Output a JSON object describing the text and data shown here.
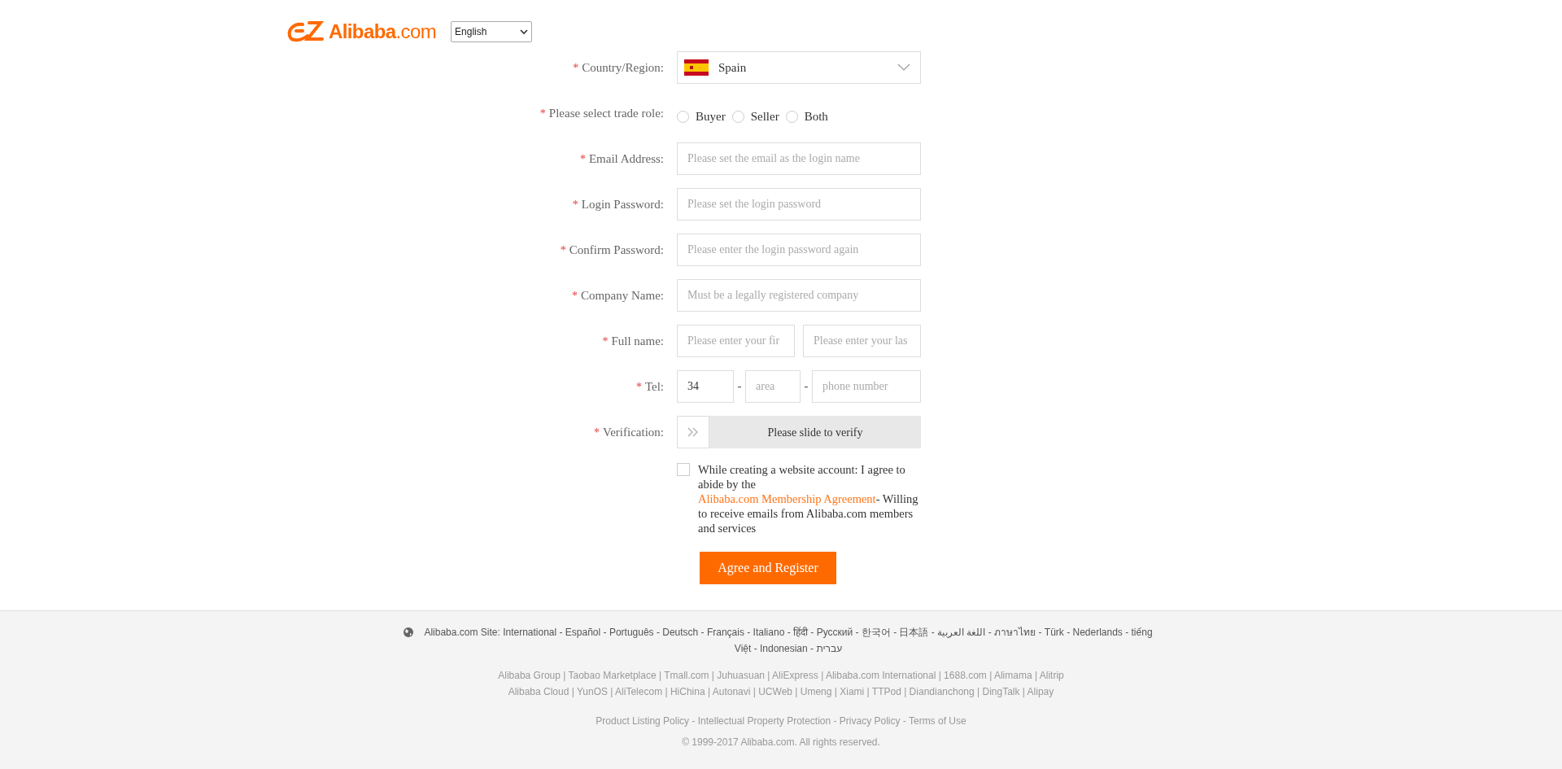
{
  "header": {
    "logo_text": "**Alibaba**.com",
    "language": "English"
  },
  "form": {
    "fields": [
      {
        "kind": "country",
        "mark": "*",
        "label": "Country/Region:",
        "value": "Spain"
      },
      {
        "kind": "radio",
        "mark": "*",
        "label": "Please select trade role:",
        "options": [
          {
            "label": "Buyer",
            "selected": false
          },
          {
            "label": "Seller",
            "selected": false
          },
          {
            "label": "Both",
            "selected": false
          }
        ]
      },
      {
        "kind": "input",
        "mark": "*",
        "label": "Email Address:",
        "placeholder": "Please set the email as the login name"
      },
      {
        "kind": "input",
        "mark": "*",
        "label": "Login Password:",
        "placeholder": "Please set the login password"
      },
      {
        "kind": "input",
        "mark": "*",
        "label": "Confirm Password:",
        "placeholder": "Please enter the login password again"
      },
      {
        "kind": "input",
        "mark": "*",
        "label": "Company Name:",
        "placeholder": "Must be a legally registered company"
      },
      {
        "kind": "pair",
        "mark": "*",
        "label": "Full name:",
        "inputs": [
          {
            "placeholder": "Please enter your fir"
          },
          {
            "placeholder": "Please enter your las"
          }
        ]
      },
      {
        "kind": "tel",
        "mark": "*",
        "label": "Tel:",
        "code": "34",
        "separators": [
          "-",
          "-"
        ],
        "inputs": [
          {
            "placeholder": "area"
          },
          {
            "placeholder": "phone number"
          }
        ]
      },
      {
        "kind": "slider",
        "mark": "*",
        "label": "Verification:",
        "text": "Please slide to verify",
        "level": 0
      }
    ],
    "agreement": {
      "checked": false,
      "before": "While creating a website account: I agree to abide by the",
      "link": "Alibaba.com Membership Agreement",
      "after": "- Willing to receive emails from Alibaba.com members and services"
    },
    "submit": "Agree and Register"
  },
  "footer": {
    "sites": "Alibaba.com Site: International - Español - Português - Deutsch - Français - Italiano - हिंदी - Русский - 한국어 - 日本語 - اللغة العربية - ภาษาไทย - Türk - Nederlands - tiếng Việt - Indonesian - עברית",
    "group_lines": [
      "Alibaba Group | Taobao Marketplace | Tmall.com | Juhuasuan | AliExpress | Alibaba.com International | 1688.com | Alimama | Alitrip",
      "Alibaba Cloud | YunOS | AliTelecom | HiChina | Autonavi | UCWeb | Umeng | Xiami | TTPod | Diandianchong | DingTalk | Alipay"
    ],
    "policies": "Product Listing Policy - Intellectual Property Protection - Privacy Policy - Terms of Use",
    "copyright": "© 1999-2017 Alibaba.com. All rights reserved."
  }
}
